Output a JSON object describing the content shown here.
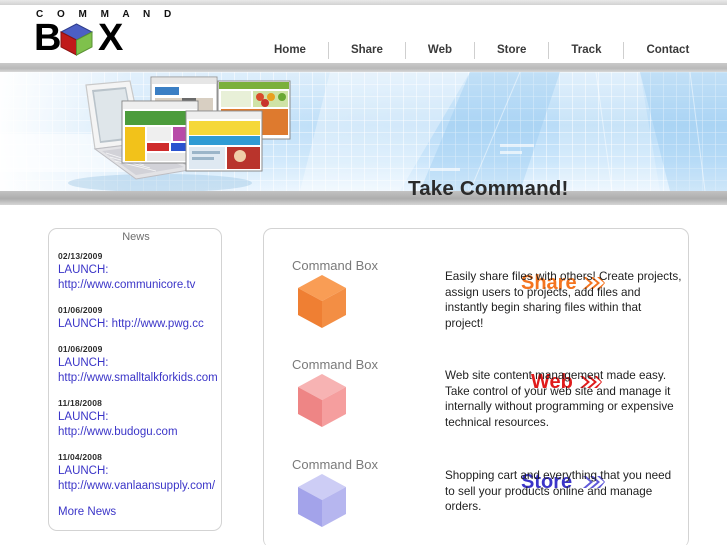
{
  "brand": {
    "word_top": "C O M M A N D",
    "letter_b": "B",
    "letter_x": "X",
    "cube_icon": "logo-cube-icon",
    "cube_colors": {
      "top": "#4c5fc4",
      "left": "#c01a1a",
      "right": "#7fc14c"
    }
  },
  "nav": {
    "items": [
      {
        "label": "Home"
      },
      {
        "label": "Share"
      },
      {
        "label": "Web"
      },
      {
        "label": "Store"
      },
      {
        "label": "Track"
      },
      {
        "label": "Contact"
      }
    ]
  },
  "banner": {
    "headline": "Take Command!",
    "art_icon": "laptop-websites-illustration"
  },
  "news": {
    "title": "News",
    "more_label": "More News",
    "items": [
      {
        "date": "02/13/2009",
        "line1": "LAUNCH:",
        "line2": "http://www.communicore.tv"
      },
      {
        "date": "01/06/2009",
        "line1": "LAUNCH: http://www.pwg.cc",
        "line2": ""
      },
      {
        "date": "01/06/2009",
        "line1": "LAUNCH:",
        "line2": "http://www.smalltalkforkids.com"
      },
      {
        "date": "11/18/2008",
        "line1": "LAUNCH:",
        "line2": "http://www.budogu.com"
      },
      {
        "date": "11/04/2008",
        "line1": "LAUNCH:",
        "line2": "http://www.vanlaansupply.com/"
      }
    ]
  },
  "products": [
    {
      "brand": "Command Box",
      "name": "Share",
      "color": "#f47b20",
      "cube_top": "#f99d55",
      "cube_left": "#f1833a",
      "cube_right": "#e9762b",
      "description": "Easily share files with others! Create projects, assign users to projects, add files and instantly begin sharing files within that project!"
    },
    {
      "brand": "Command Box",
      "name": "Web",
      "color": "#e01b1b",
      "cube_top": "#f5a6a6",
      "cube_left": "#f08f8f",
      "cube_right": "#ef8c8c",
      "description": "Web site content management made easy. Take control of your web site and manage it internally without programming or expensive technical resources."
    },
    {
      "brand": "Command Box",
      "name": "Store",
      "color": "#3b35c8",
      "cube_top": "#c3c3f2",
      "cube_left": "#a9a9ec",
      "cube_right": "#9a9aea",
      "description": "Shopping cart and everything that you need to sell your products online and manage orders."
    }
  ]
}
